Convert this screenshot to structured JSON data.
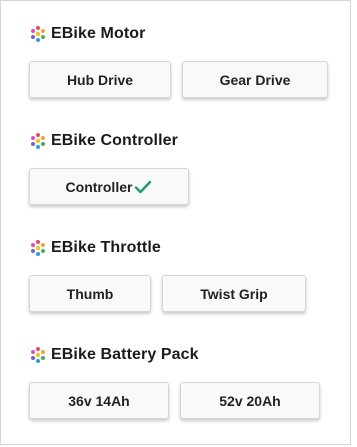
{
  "sections": [
    {
      "title": "EBike Motor",
      "icon": "multicolor-gear-icon",
      "options": [
        {
          "label": "Hub Drive",
          "selected": false
        },
        {
          "label": "Gear Drive",
          "selected": false
        }
      ]
    },
    {
      "title": "EBike Controller",
      "icon": "multicolor-gear-icon",
      "options": [
        {
          "label": "Controller",
          "selected": true,
          "icon": "check-icon"
        }
      ]
    },
    {
      "title": "EBike Throttle",
      "icon": "multicolor-gear-icon",
      "options": [
        {
          "label": "Thumb",
          "selected": false
        },
        {
          "label": "Twist Grip",
          "selected": false
        }
      ]
    },
    {
      "title": "EBike Battery Pack",
      "icon": "multicolor-gear-icon",
      "options": [
        {
          "label": "36v 14Ah",
          "selected": false
        },
        {
          "label": "52v 20Ah",
          "selected": false
        }
      ]
    }
  ],
  "colors": {
    "check": "#1e9a6a",
    "title_text": "#1c1c1c",
    "button_bg": "#f9f9f9",
    "button_border": "#d6d6d6"
  }
}
